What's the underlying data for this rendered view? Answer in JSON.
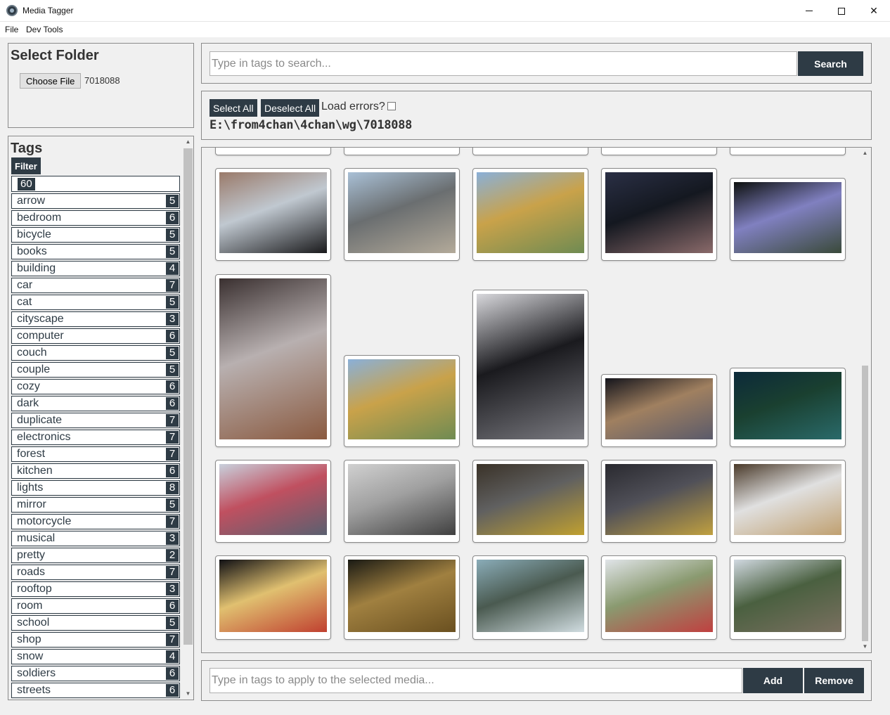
{
  "window": {
    "title": "Media Tagger",
    "minimize": "",
    "close": "✕"
  },
  "menu": [
    "File",
    "Dev Tools"
  ],
  "folder": {
    "title": "Select Folder",
    "choose_label": "Choose File",
    "file_name": "7018088"
  },
  "tags": {
    "title": "Tags",
    "filter_label": "Filter",
    "total": "60",
    "items": [
      {
        "name": "arrow",
        "count": "5"
      },
      {
        "name": "bedroom",
        "count": "6"
      },
      {
        "name": "bicycle",
        "count": "5"
      },
      {
        "name": "books",
        "count": "5"
      },
      {
        "name": "building",
        "count": "4"
      },
      {
        "name": "car",
        "count": "7"
      },
      {
        "name": "cat",
        "count": "5"
      },
      {
        "name": "cityscape",
        "count": "3"
      },
      {
        "name": "computer",
        "count": "6"
      },
      {
        "name": "couch",
        "count": "5"
      },
      {
        "name": "couple",
        "count": "5"
      },
      {
        "name": "cozy",
        "count": "6"
      },
      {
        "name": "dark",
        "count": "6"
      },
      {
        "name": "duplicate",
        "count": "7"
      },
      {
        "name": "electronics",
        "count": "7"
      },
      {
        "name": "forest",
        "count": "7"
      },
      {
        "name": "kitchen",
        "count": "6"
      },
      {
        "name": "lights",
        "count": "8"
      },
      {
        "name": "mirror",
        "count": "5"
      },
      {
        "name": "motorcycle",
        "count": "7"
      },
      {
        "name": "musical",
        "count": "3"
      },
      {
        "name": "pretty",
        "count": "2"
      },
      {
        "name": "roads",
        "count": "7"
      },
      {
        "name": "rooftop",
        "count": "3"
      },
      {
        "name": "room",
        "count": "6"
      },
      {
        "name": "school",
        "count": "5"
      },
      {
        "name": "shop",
        "count": "7"
      },
      {
        "name": "snow",
        "count": "4"
      },
      {
        "name": "soldiers",
        "count": "6"
      },
      {
        "name": "streets",
        "count": "6"
      }
    ]
  },
  "search": {
    "placeholder": "Type in tags to search...",
    "button": "Search"
  },
  "selection": {
    "select_all": "Select All",
    "deselect_all": "Deselect All",
    "load_errors_label": "Load errors?",
    "load_errors_checked": false,
    "path": "E:\\from4chan\\4chan\\wg\\7018088"
  },
  "gallery": {
    "thumbnails": [
      {
        "name": "street-taxis-photo",
        "colors": [
          "#9a7a6a",
          "#1a1a1c",
          "#c0c8d0"
        ]
      },
      {
        "name": "park-skyline-photo",
        "colors": [
          "#a9c0d6",
          "#b3aa9a",
          "#6a6e70"
        ]
      },
      {
        "name": "green-tower-gold-photo",
        "colors": [
          "#8ab0d8",
          "#6f8b52",
          "#c9a24a"
        ]
      },
      {
        "name": "night-city-window-photo",
        "colors": [
          "#2a2f45",
          "#8a6a6a",
          "#141820"
        ]
      },
      {
        "name": "night-path-lamp-photo",
        "colors": [
          "#0e1110",
          "#3a4a3a",
          "#8080c0"
        ]
      },
      {
        "name": "rainy-alley-photo",
        "colors": [
          "#3a3030",
          "#8a5a40",
          "#b8b0b0"
        ]
      },
      {
        "name": "green-tower-gold-duplicate-photo",
        "colors": [
          "#8ab0d8",
          "#6f8b52",
          "#c9a24a"
        ]
      },
      {
        "name": "tokyo-tower-fog-photo",
        "colors": [
          "#d8d8dc",
          "#7a7a80",
          "#1a1a1e"
        ]
      },
      {
        "name": "night-buildings-photo",
        "colors": [
          "#15151c",
          "#5a5a6a",
          "#a08060"
        ]
      },
      {
        "name": "night-park-bench-photo",
        "colors": [
          "#0c2a3a",
          "#2a6a6a",
          "#1a4030"
        ]
      },
      {
        "name": "city-street-day-photo",
        "colors": [
          "#c8d0dc",
          "#5a6070",
          "#c05060"
        ]
      },
      {
        "name": "electronics-store-photo",
        "colors": [
          "#d0d0d0",
          "#404040",
          "#a0a0a0"
        ]
      },
      {
        "name": "crosswalk-evening-photo",
        "colors": [
          "#3a3228",
          "#c0a030",
          "#606060"
        ]
      },
      {
        "name": "evening-plaza-photo",
        "colors": [
          "#2a2a30",
          "#c0a040",
          "#505058"
        ]
      },
      {
        "name": "shop-businessman-photo",
        "colors": [
          "#4a3a2a",
          "#c0a070",
          "#e0e0e0"
        ]
      },
      {
        "name": "neon-street-night-photo",
        "colors": [
          "#101014",
          "#c04030",
          "#e0c070"
        ]
      },
      {
        "name": "narrow-alley-night-photo",
        "colors": [
          "#1a1a14",
          "#6a5020",
          "#a08040"
        ]
      },
      {
        "name": "mount-fuji-view-photo",
        "colors": [
          "#8aacb8",
          "#d0dce0",
          "#4a5a50"
        ]
      },
      {
        "name": "vending-machines-photo",
        "colors": [
          "#e0e4e8",
          "#c04040",
          "#8a9a70"
        ]
      },
      {
        "name": "quiet-street-houses-photo",
        "colors": [
          "#d0d8e0",
          "#7a7060",
          "#4a6040"
        ]
      }
    ]
  },
  "apply": {
    "placeholder": "Type in tags to apply to the selected media...",
    "add": "Add",
    "remove": "Remove"
  }
}
